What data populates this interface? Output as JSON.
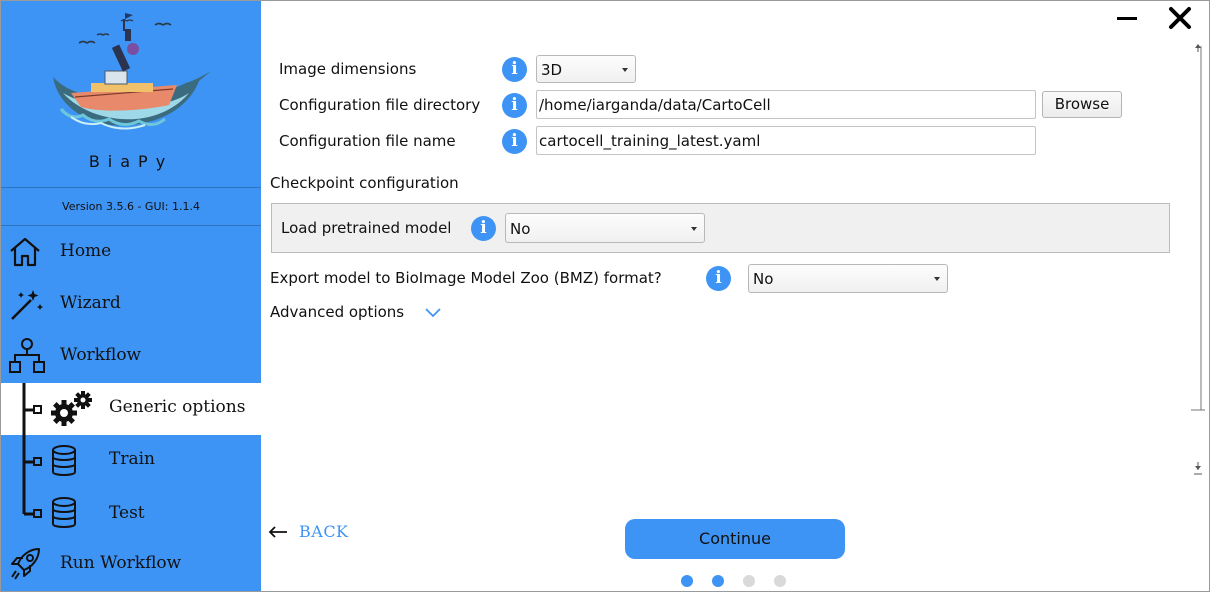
{
  "app": {
    "brand": "BiaPy",
    "version": "Version 3.5.6 - GUI: 1.1.4"
  },
  "window_controls": {
    "minimize_icon": "minimize-icon",
    "close_icon": "close-icon"
  },
  "sidebar": {
    "items": [
      {
        "label": "Home",
        "icon": "home-icon"
      },
      {
        "label": "Wizard",
        "icon": "magic-wand-icon"
      },
      {
        "label": "Workflow",
        "icon": "workflow-icon"
      },
      {
        "label": "Generic options",
        "icon": "gears-icon",
        "active": true
      },
      {
        "label": "Train",
        "icon": "database-icon"
      },
      {
        "label": "Test",
        "icon": "database-icon"
      },
      {
        "label": "Run Workflow",
        "icon": "rocket-icon"
      }
    ]
  },
  "form": {
    "image_dimensions": {
      "label": "Image dimensions",
      "value": "3D"
    },
    "config_dir": {
      "label": "Configuration file directory",
      "value": "/home/iarganda/data/CartoCell",
      "browse_label": "Browse"
    },
    "config_name": {
      "label": "Configuration file name",
      "value": "cartocell_training_latest.yaml"
    },
    "checkpoint_title": "Checkpoint configuration",
    "load_pretrained": {
      "label": "Load pretrained model",
      "value": "No"
    },
    "export_bmz": {
      "label": "Export model to BioImage Model Zoo (BMZ) format?",
      "value": "No"
    },
    "advanced": {
      "label": "Advanced options"
    }
  },
  "info_glyph": "i",
  "footer": {
    "back_label": "BACK",
    "continue_label": "Continue",
    "page_dots": {
      "total": 4,
      "completed": 2
    }
  },
  "colors": {
    "accent": "#3e94f4",
    "dot_inactive": "#d9d9d9"
  }
}
